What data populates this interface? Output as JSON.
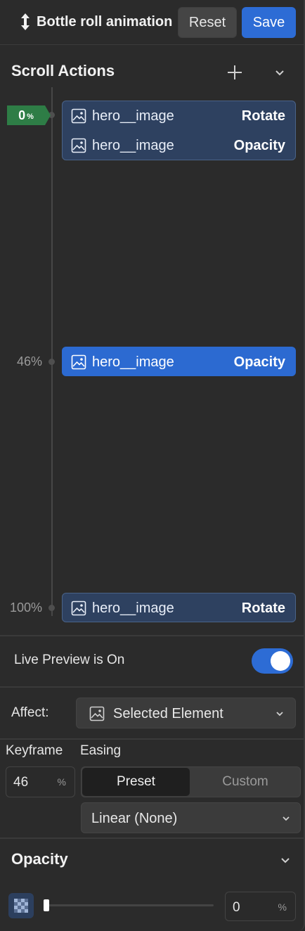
{
  "header": {
    "title": "Bottle roll animation",
    "reset_label": "Reset",
    "save_label": "Save",
    "title_icon": "vertical-arrows-icon"
  },
  "scroll_actions": {
    "title": "Scroll Actions",
    "current_marker": {
      "value": "0",
      "unit": "%"
    },
    "keyframes": [
      {
        "label": "",
        "percent": 0,
        "active": false,
        "rows": [
          {
            "element": "hero__image",
            "action": "Rotate"
          },
          {
            "element": "hero__image",
            "action": "Opacity"
          }
        ]
      },
      {
        "label": "46%",
        "percent": 46,
        "active": true,
        "rows": [
          {
            "element": "hero__image",
            "action": "Opacity"
          }
        ]
      },
      {
        "label": "100%",
        "percent": 100,
        "active": false,
        "rows": [
          {
            "element": "hero__image",
            "action": "Rotate"
          }
        ]
      }
    ]
  },
  "live_preview": {
    "label": "Live Preview is On",
    "enabled": true
  },
  "affect": {
    "label": "Affect:",
    "value": "Selected Element"
  },
  "keyframe": {
    "label": "Keyframe",
    "value": "46",
    "unit": "%"
  },
  "easing": {
    "label": "Easing",
    "tabs": [
      "Preset",
      "Custom"
    ],
    "selected_tab": "Preset",
    "preset_value": "Linear (None)"
  },
  "opacity": {
    "title": "Opacity",
    "value": "0",
    "unit": "%",
    "level": 0
  },
  "colors": {
    "accent": "#2d6cd5",
    "marker": "#2e7d46",
    "group_bg": "#2e4160",
    "panel_bg": "#2b2b2b"
  }
}
